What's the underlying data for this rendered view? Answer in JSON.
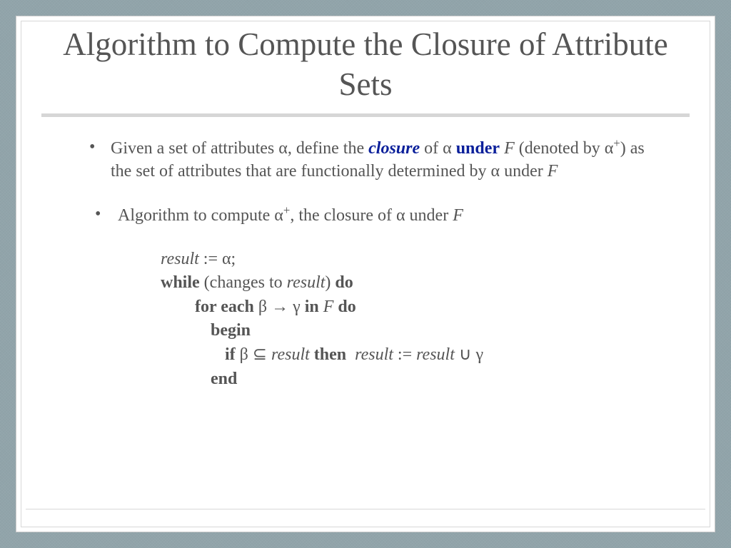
{
  "title": "Algorithm to Compute the Closure of Attribute Sets",
  "bullets": {
    "b1_pre": "Given a set of attributes α, define the ",
    "b1_closure": "closure",
    "b1_of": " of α ",
    "b1_under": "under",
    "b1_F": " F ",
    "b1_post": "(denoted by α",
    "b1_sup": "+",
    "b1_post2": ") as the set of attributes that are functionally determined by α under ",
    "b1_F2": "F",
    "b2_pre": "Algorithm to compute α",
    "b2_sup": "+",
    "b2_mid": ", the closure of α under ",
    "b2_F": "F"
  },
  "algo": {
    "l1_result": "result",
    "l1_assign": " := α;",
    "l2_while": "while",
    "l2_paren": " (changes to ",
    "l2_result": "result",
    "l2_close": ") ",
    "l2_do": "do",
    "l3_for": "for each",
    "l3_expr": " β → γ ",
    "l3_in": "in",
    "l3_F": " F ",
    "l3_do": "do",
    "l4_begin": "begin",
    "l5_if": "if",
    "l5_cond": " β ⊆ ",
    "l5_result": "result ",
    "l5_then": "then",
    "l5_sp": "  ",
    "l5_result2": "result",
    "l5_assign": " := ",
    "l5_result3": "result",
    "l5_union": " ∪ γ",
    "l6_end": "end"
  }
}
